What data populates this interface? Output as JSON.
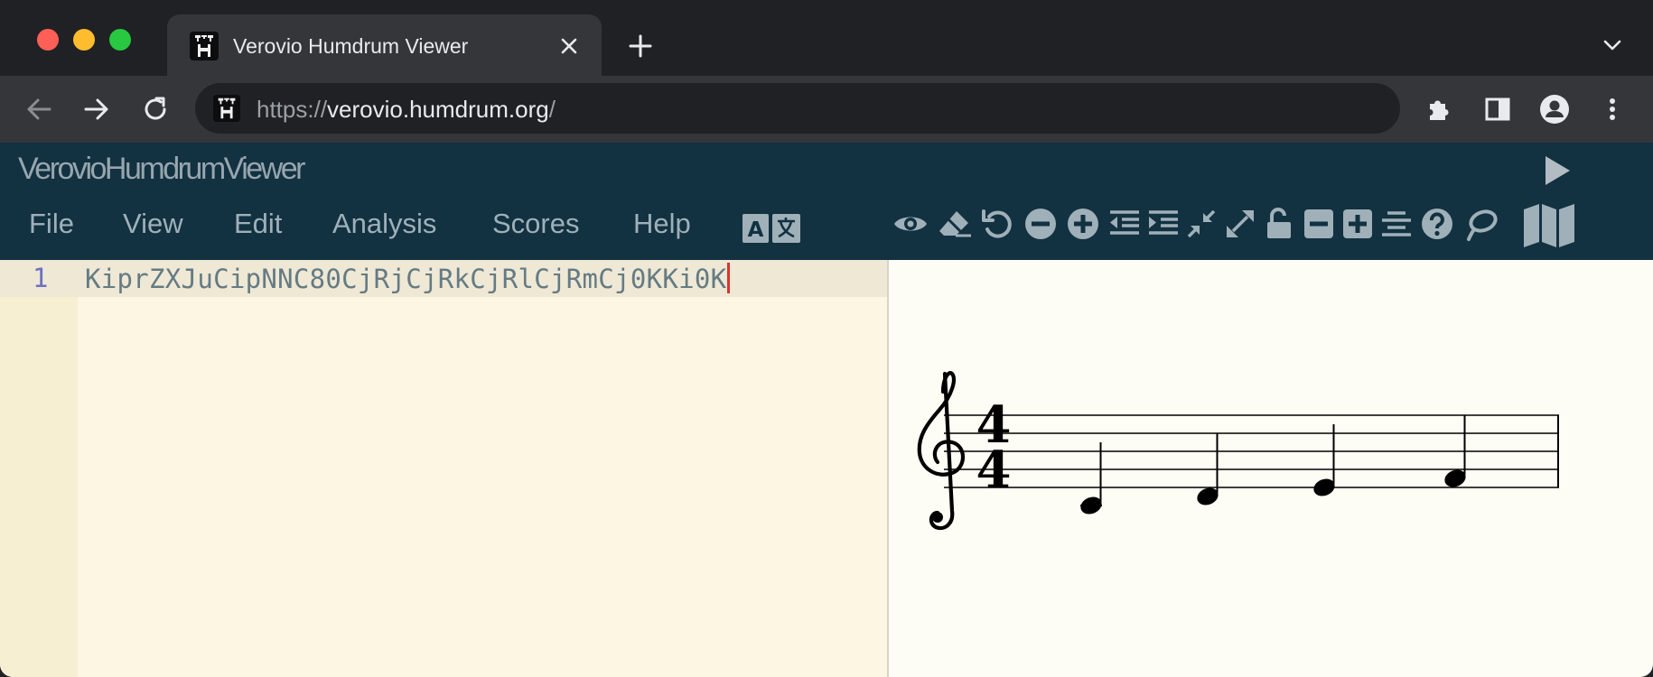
{
  "browser": {
    "tab_title": "Verovio Humdrum Viewer",
    "url_scheme": "https://",
    "url_host": "verovio.humdrum.org",
    "url_path": "/"
  },
  "app": {
    "title": "VerovioHumdrumViewer",
    "menu": [
      {
        "label": "File"
      },
      {
        "label": "View"
      },
      {
        "label": "Edit"
      },
      {
        "label": "Analysis"
      },
      {
        "label": "Scores"
      },
      {
        "label": "Help"
      }
    ],
    "tools": [
      "eye-icon",
      "eraser-icon",
      "undo-icon",
      "zoom-out-icon",
      "zoom-in-icon",
      "outdent-icon",
      "indent-icon",
      "compress-icon",
      "expand-icon",
      "unlock-icon",
      "minus-square-icon",
      "plus-square-icon",
      "align-center-icon",
      "help-icon",
      "lasso-icon",
      "map-icon"
    ]
  },
  "editor": {
    "line_number": "1",
    "code": "KiprZXJuCipNNC80CjRjCjRkCjRlCjRmCj0KKi0K"
  },
  "notation": {
    "clef": "treble",
    "time_signature_top": "4",
    "time_signature_bottom": "4",
    "notes": [
      "C4",
      "D4",
      "E4",
      "F4"
    ],
    "duration": "quarter"
  }
}
